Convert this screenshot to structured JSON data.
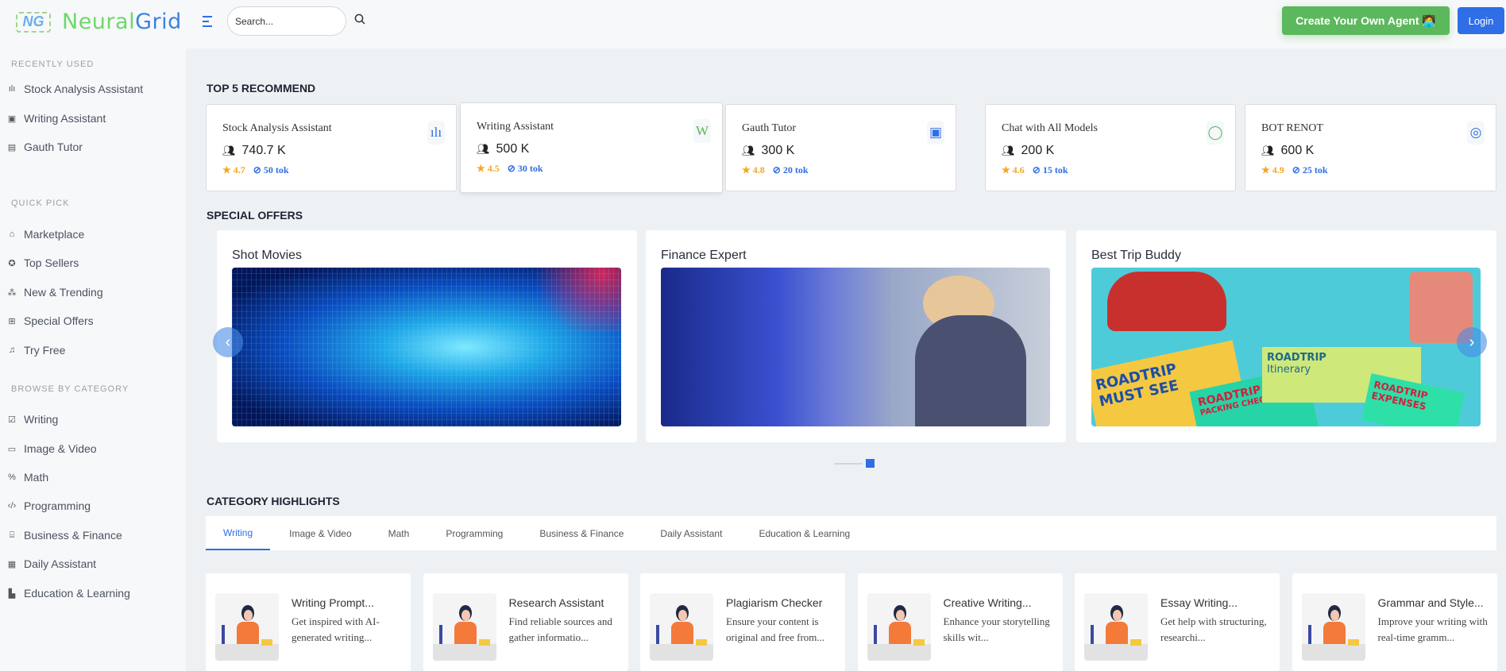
{
  "header": {
    "logo_mark": "NG",
    "logo_part1": "Neural",
    "logo_part2": "Grid",
    "search_placeholder": "Search...",
    "create_button": "Create Your Own Agent 🧑‍💻",
    "login_button": "Login"
  },
  "sidebar": {
    "recent_label": "RECENTLY USED",
    "recent": [
      {
        "label": "Stock Analysis Assistant",
        "icon": "bar-chart-icon"
      },
      {
        "label": "Writing Assistant",
        "icon": "word-doc-icon"
      },
      {
        "label": "Gauth Tutor",
        "icon": "news-icon"
      }
    ],
    "quick_label": "QUICK PICK",
    "quick": [
      {
        "label": "Marketplace",
        "icon": "store-icon"
      },
      {
        "label": "Top Sellers",
        "icon": "medal-icon"
      },
      {
        "label": "New & Trending",
        "icon": "trending-icon"
      },
      {
        "label": "Special Offers",
        "icon": "gift-icon"
      },
      {
        "label": "Try Free",
        "icon": "bell-icon"
      }
    ],
    "browse_label": "BROWSE BY CATEGORY",
    "browse": [
      {
        "label": "Writing",
        "icon": "edit-icon"
      },
      {
        "label": "Image & Video",
        "icon": "monitor-icon"
      },
      {
        "label": "Math",
        "icon": "percent-icon"
      },
      {
        "label": "Programming",
        "icon": "code-icon"
      },
      {
        "label": "Business & Finance",
        "icon": "bank-icon"
      },
      {
        "label": "Daily Assistant",
        "icon": "calendar-icon"
      },
      {
        "label": "Education & Learning",
        "icon": "book-icon"
      }
    ]
  },
  "top5": {
    "title": "TOP 5 RECOMMEND",
    "items": [
      {
        "name": "Stock Analysis Assistant",
        "users": "740.7 K",
        "rating": "4.7",
        "tokens": "50 tok",
        "icon": "bar-chart-icon",
        "color": "#2f6ee6"
      },
      {
        "name": "Writing Assistant",
        "users": "500 K",
        "rating": "4.5",
        "tokens": "30 tok",
        "icon": "word-doc-icon",
        "color": "#5cb85c"
      },
      {
        "name": "Gauth Tutor",
        "users": "300 K",
        "rating": "4.8",
        "tokens": "20 tok",
        "icon": "news-icon",
        "color": "#2f6ee6"
      },
      {
        "name": "Chat with All Models",
        "users": "200 K",
        "rating": "4.6",
        "tokens": "15 tok",
        "icon": "chat-bubble-icon",
        "color": "#5cb85c"
      },
      {
        "name": "BOT RENOT",
        "users": "600 K",
        "rating": "4.9",
        "tokens": "25 tok",
        "icon": "robot-icon",
        "color": "#2f6ee6"
      }
    ]
  },
  "offers": {
    "title": "SPECIAL OFFERS",
    "items": [
      {
        "title": "Shot Movies"
      },
      {
        "title": "Finance Expert"
      },
      {
        "title": "Best Trip Buddy"
      }
    ],
    "trip_texts": [
      "ROADTRIP",
      "MUST SEE",
      "ROADTRIP",
      "PACKING CHECKLIST",
      "ROADTRIP",
      "Itinerary",
      "ROADTRIP",
      "EXPENSES"
    ]
  },
  "categories": {
    "title": "CATEGORY HIGHLIGHTS",
    "tabs": [
      "Writing",
      "Image & Video",
      "Math",
      "Programming",
      "Business & Finance",
      "Daily Assistant",
      "Education & Learning"
    ],
    "active_tab": "Writing",
    "cards": [
      {
        "title": "Writing Prompt...",
        "desc": "Get inspired with AI-generated writing..."
      },
      {
        "title": "Research Assistant",
        "desc": "Find reliable sources and gather informatio..."
      },
      {
        "title": "Plagiarism Checker",
        "desc": "Ensure your content is original and free from..."
      },
      {
        "title": "Creative Writing...",
        "desc": "Enhance your storytelling skills wit..."
      },
      {
        "title": "Essay Writing...",
        "desc": "Get help with structuring, researchi..."
      },
      {
        "title": "Grammar and Style...",
        "desc": "Improve your writing with real-time gramm..."
      }
    ]
  }
}
